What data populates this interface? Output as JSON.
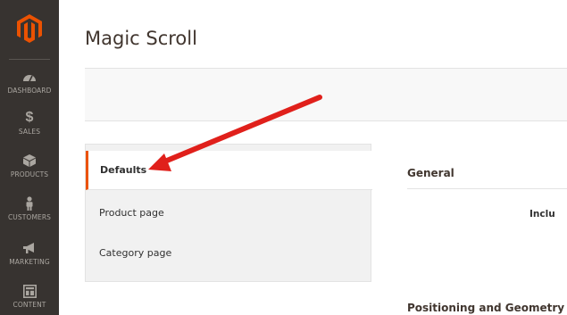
{
  "colors": {
    "sidebar_bg": "#373330",
    "brand_orange": "#eb5202",
    "annotation_red": "#e0201b"
  },
  "sidebar": {
    "logo_icon": "magento-logo-icon",
    "items": [
      {
        "label": "DASHBOARD",
        "icon": "speedometer-icon"
      },
      {
        "label": "SALES",
        "icon": "dollar-icon"
      },
      {
        "label": "PRODUCTS",
        "icon": "box-icon"
      },
      {
        "label": "CUSTOMERS",
        "icon": "person-icon"
      },
      {
        "label": "MARKETING",
        "icon": "megaphone-icon"
      },
      {
        "label": "CONTENT",
        "icon": "layout-icon"
      }
    ]
  },
  "page": {
    "title": "Magic Scroll"
  },
  "tabs": [
    {
      "label": "Defaults",
      "active": true
    },
    {
      "label": "Product page",
      "active": false
    },
    {
      "label": "Category page",
      "active": false
    }
  ],
  "content": {
    "section_general": "General",
    "field_label_partial": "Inclu",
    "section_positioning": "Positioning and Geometry"
  }
}
